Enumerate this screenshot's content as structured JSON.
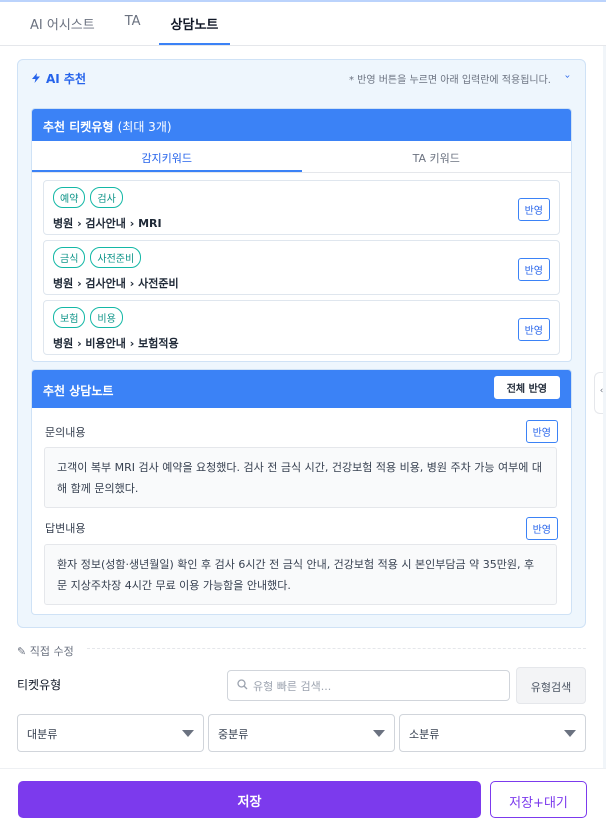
{
  "tabs": [
    {
      "label": "AI 어시스트"
    },
    {
      "label": "TA"
    },
    {
      "label": "상담노트"
    }
  ],
  "ai": {
    "title": "AI 추천",
    "hint": "* 반영 버튼을 누르면 아래 입력란에 적용됩니다.",
    "toggle_icon": "chevron-down-icon"
  },
  "ticket_types": {
    "title": "추천 티켓유형",
    "subtitle": "(최대 3개)",
    "tabs": [
      {
        "label": "감지키워드"
      },
      {
        "label": "TA 키워드"
      }
    ],
    "items": [
      {
        "chips": [
          "예약",
          "검사"
        ],
        "path": "병원 › 검사안내 › MRI",
        "apply_label": "반영"
      },
      {
        "chips": [
          "금식",
          "사전준비"
        ],
        "path": "병원 › 검사안내 › 사전준비",
        "apply_label": "반영"
      },
      {
        "chips": [
          "보험",
          "비용"
        ],
        "path": "병원 › 비용안내 › 보험적용",
        "apply_label": "반영"
      }
    ]
  },
  "notes": {
    "title": "추천 상담노트",
    "apply_all_label": "전체 반영",
    "inquiry": {
      "label": "문의내용",
      "apply_label": "반영",
      "text": "고객이 복부 MRI 검사 예약을 요청했다. 검사 전 금식 시간, 건강보험 적용 비용, 병원 주차 가능 여부에 대해 함께 문의했다."
    },
    "answer": {
      "label": "답변내용",
      "apply_label": "반영",
      "text": "환자 정보(성함·생년월일) 확인 후 검사 6시간 전 금식 안내, 건강보험 적용 시 본인부담금 약 35만원, 후문 지상주차장 4시간 무료 이용 가능함을 안내했다."
    }
  },
  "edit": {
    "label": "직접 수정",
    "ticket_type_label": "티켓유형",
    "search_placeholder": "유형 빠른 검색...",
    "search_button": "유형검색",
    "selects": [
      {
        "value": "대분류"
      },
      {
        "value": "중분류"
      },
      {
        "value": "소분류"
      }
    ]
  },
  "footer": {
    "save_label": "저장",
    "save_wait_label": "저장+대기"
  },
  "colors": {
    "accent": "#3b82f6",
    "primary_button": "#7c3aed",
    "chip": "#14b8a6"
  }
}
